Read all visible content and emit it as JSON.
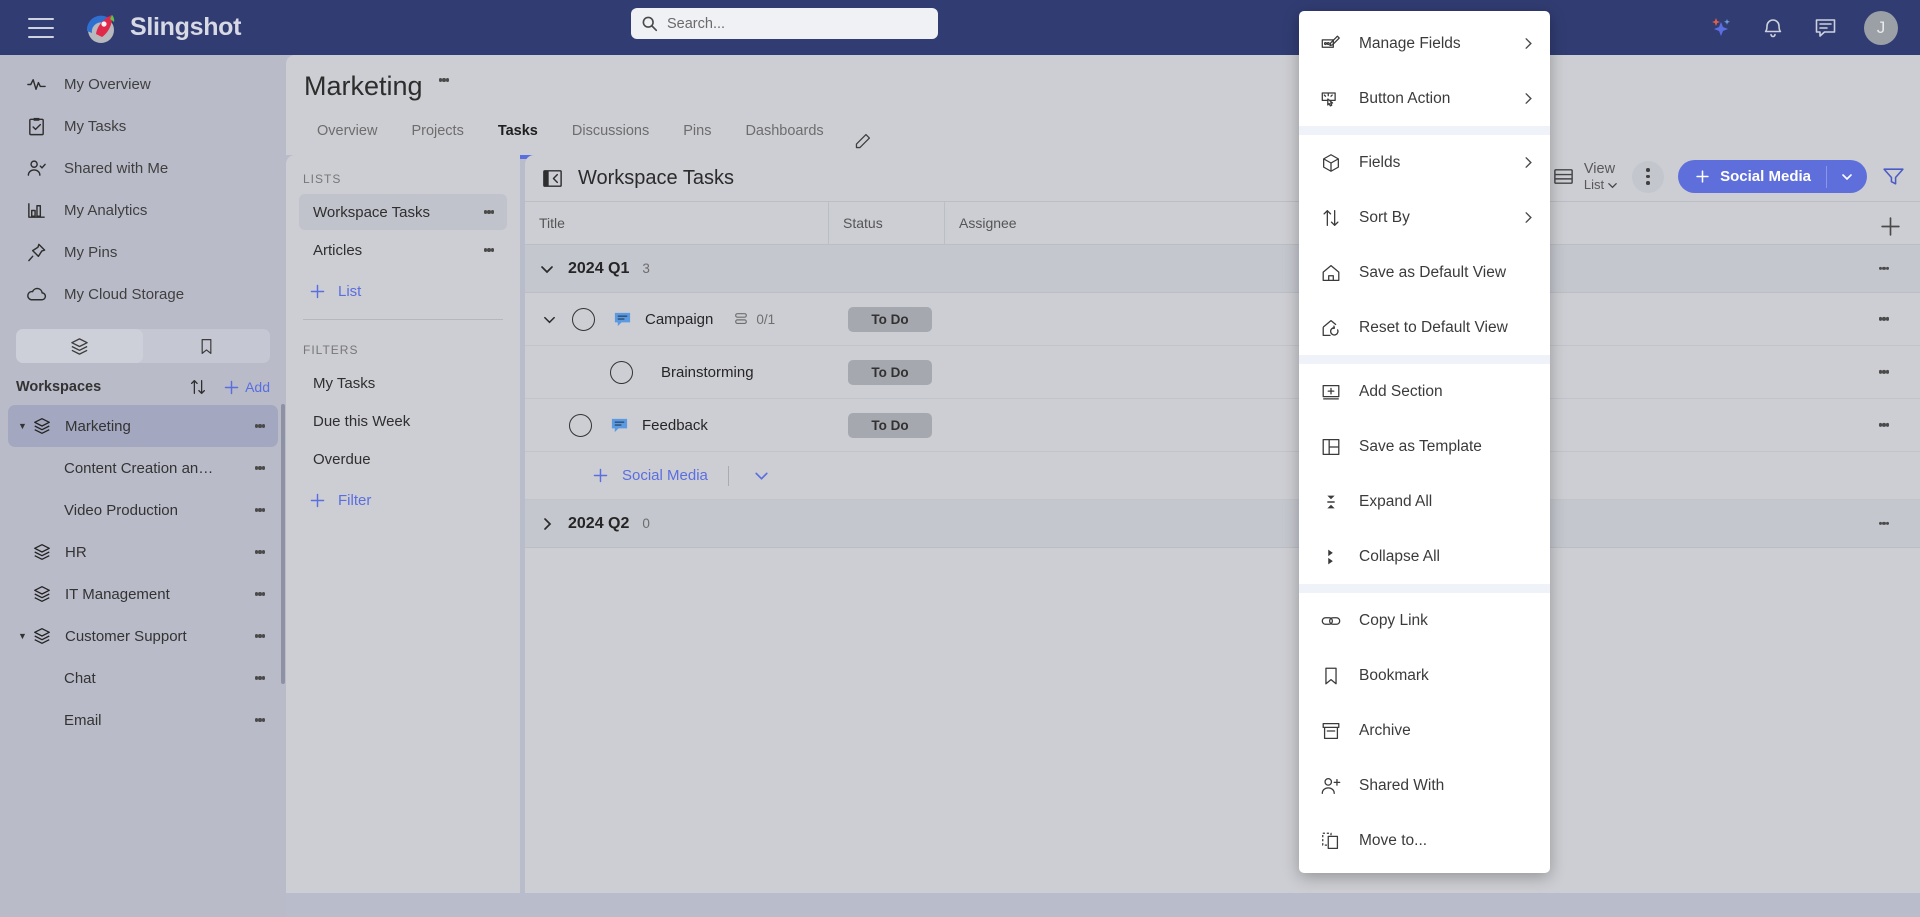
{
  "app": {
    "brand": "Slingshot",
    "menu_icon": "hamburger-icon",
    "avatar_initial": "J"
  },
  "search": {
    "placeholder": "Search...",
    "value": ""
  },
  "topbar_icons": [
    {
      "name": "ai-sparkle-icon"
    },
    {
      "name": "notifications-bell-icon"
    },
    {
      "name": "chat-icon"
    }
  ],
  "sidebar": {
    "nav": [
      {
        "label": "My Overview",
        "icon": "activity-icon"
      },
      {
        "label": "My Tasks",
        "icon": "clipboard-check-icon"
      },
      {
        "label": "Shared with Me",
        "icon": "user-check-icon"
      },
      {
        "label": "My Analytics",
        "icon": "bar-chart-icon"
      },
      {
        "label": "My Pins",
        "icon": "pin-icon"
      },
      {
        "label": "My Cloud Storage",
        "icon": "cloud-icon"
      }
    ],
    "toggle": [
      {
        "name": "workspaces-tab",
        "icon": "layers-icon",
        "active": true
      },
      {
        "name": "bookmarks-tab",
        "icon": "bookmark-icon",
        "active": false
      }
    ],
    "workspaces_header": {
      "title": "Workspaces",
      "sort_icon": "sort-arrows-icon",
      "add_label": "Add",
      "add_icon": "plus-icon"
    },
    "workspaces": [
      {
        "label": "Marketing",
        "level": 0,
        "expanded": true,
        "selected": true,
        "icon": "layers-icon"
      },
      {
        "label": "Content Creation an…",
        "level": 1,
        "expanded": false,
        "selected": false,
        "icon": ""
      },
      {
        "label": "Video Production",
        "level": 1,
        "expanded": false,
        "selected": false,
        "icon": ""
      },
      {
        "label": "HR",
        "level": 0,
        "expanded": false,
        "selected": false,
        "icon": "layers-icon"
      },
      {
        "label": "IT Management",
        "level": 0,
        "expanded": false,
        "selected": false,
        "icon": "layers-icon"
      },
      {
        "label": "Customer Support",
        "level": 0,
        "expanded": true,
        "selected": false,
        "icon": "layers-icon"
      },
      {
        "label": "Chat",
        "level": 1,
        "expanded": false,
        "selected": false,
        "icon": ""
      },
      {
        "label": "Email",
        "level": 1,
        "expanded": false,
        "selected": false,
        "icon": ""
      }
    ]
  },
  "workspace": {
    "name": "Marketing",
    "tabs": [
      {
        "label": "Overview",
        "active": false
      },
      {
        "label": "Projects",
        "active": false
      },
      {
        "label": "Tasks",
        "active": true
      },
      {
        "label": "Discussions",
        "active": false
      },
      {
        "label": "Pins",
        "active": false
      },
      {
        "label": "Dashboards",
        "active": false
      }
    ],
    "edit_icon": "pencil-icon"
  },
  "lists_panel": {
    "lists_header": "LISTS",
    "lists": [
      {
        "label": "Workspace Tasks",
        "selected": true
      },
      {
        "label": "Articles",
        "selected": false
      }
    ],
    "add_list_label": "List",
    "filters_header": "FILTERS",
    "filters": [
      {
        "label": "My Tasks"
      },
      {
        "label": "Due this Week"
      },
      {
        "label": "Overdue"
      }
    ],
    "add_filter_label": "Filter"
  },
  "task_panel": {
    "title": "Workspace Tasks",
    "collapse_icon": "panel-collapse-icon",
    "view": {
      "line1": "View",
      "line2": "List",
      "icon": "list-view-icon"
    },
    "add_button": {
      "label": "Social Media",
      "plus_icon": "plus-icon",
      "caret_icon": "chevron-down-icon"
    },
    "filter_icon": "filter-icon",
    "more_icon": "ellipsis-vertical-icon",
    "columns": [
      "Title",
      "Status",
      "Assignee"
    ],
    "add_column_icon": "plus-icon",
    "groups": [
      {
        "name": "2024 Q1",
        "count": "3",
        "expanded": true,
        "rows": [
          {
            "title": "Campaign",
            "status": "To Do",
            "indent": 0,
            "has_chevron": true,
            "has_comment": true,
            "subtasks": "0/1"
          },
          {
            "title": "Brainstorming",
            "status": "To Do",
            "indent": 1,
            "has_chevron": false,
            "has_comment": false,
            "subtasks": ""
          },
          {
            "title": "Feedback",
            "status": "To Do",
            "indent": 0,
            "has_chevron": false,
            "has_comment": true,
            "subtasks": ""
          }
        ],
        "add_row_label": "Social Media"
      },
      {
        "name": "2024 Q2",
        "count": "0",
        "expanded": false,
        "rows": [],
        "add_row_label": ""
      }
    ]
  },
  "context_menu": {
    "items": [
      {
        "label": "Manage Fields",
        "icon": "manage-fields-icon",
        "arrow": true,
        "sep_after": false
      },
      {
        "label": "Button Action",
        "icon": "button-action-icon",
        "arrow": true,
        "sep_after": true
      },
      {
        "label": "Fields",
        "icon": "box-icon",
        "arrow": true,
        "sep_after": false
      },
      {
        "label": "Sort By",
        "icon": "sort-arrows-icon",
        "arrow": true,
        "sep_after": false
      },
      {
        "label": "Save as Default View",
        "icon": "home-icon",
        "arrow": false,
        "sep_after": false
      },
      {
        "label": "Reset to Default View",
        "icon": "home-reset-icon",
        "arrow": false,
        "sep_after": true
      },
      {
        "label": "Add Section",
        "icon": "add-section-icon",
        "arrow": false,
        "sep_after": false
      },
      {
        "label": "Save as Template",
        "icon": "template-icon",
        "arrow": false,
        "sep_after": false
      },
      {
        "label": "Expand All",
        "icon": "expand-all-icon",
        "arrow": false,
        "sep_after": false
      },
      {
        "label": "Collapse All",
        "icon": "collapse-all-icon",
        "arrow": false,
        "sep_after": true
      },
      {
        "label": "Copy Link",
        "icon": "link-icon",
        "arrow": false,
        "sep_after": false
      },
      {
        "label": "Bookmark",
        "icon": "bookmark-icon",
        "arrow": false,
        "sep_after": false
      },
      {
        "label": "Archive",
        "icon": "archive-icon",
        "arrow": false,
        "sep_after": false
      },
      {
        "label": "Shared With",
        "icon": "user-plus-icon",
        "arrow": false,
        "sep_after": false
      },
      {
        "label": "Move to...",
        "icon": "move-to-icon",
        "arrow": false,
        "sep_after": false
      }
    ]
  },
  "colors": {
    "topbar": "#313c72",
    "accent": "#5b6ee0",
    "panel": "#cdced3",
    "rail": "#b9bcc8",
    "selected_ws": "#a3a8c0",
    "status_chip": "#a6a8b0"
  }
}
